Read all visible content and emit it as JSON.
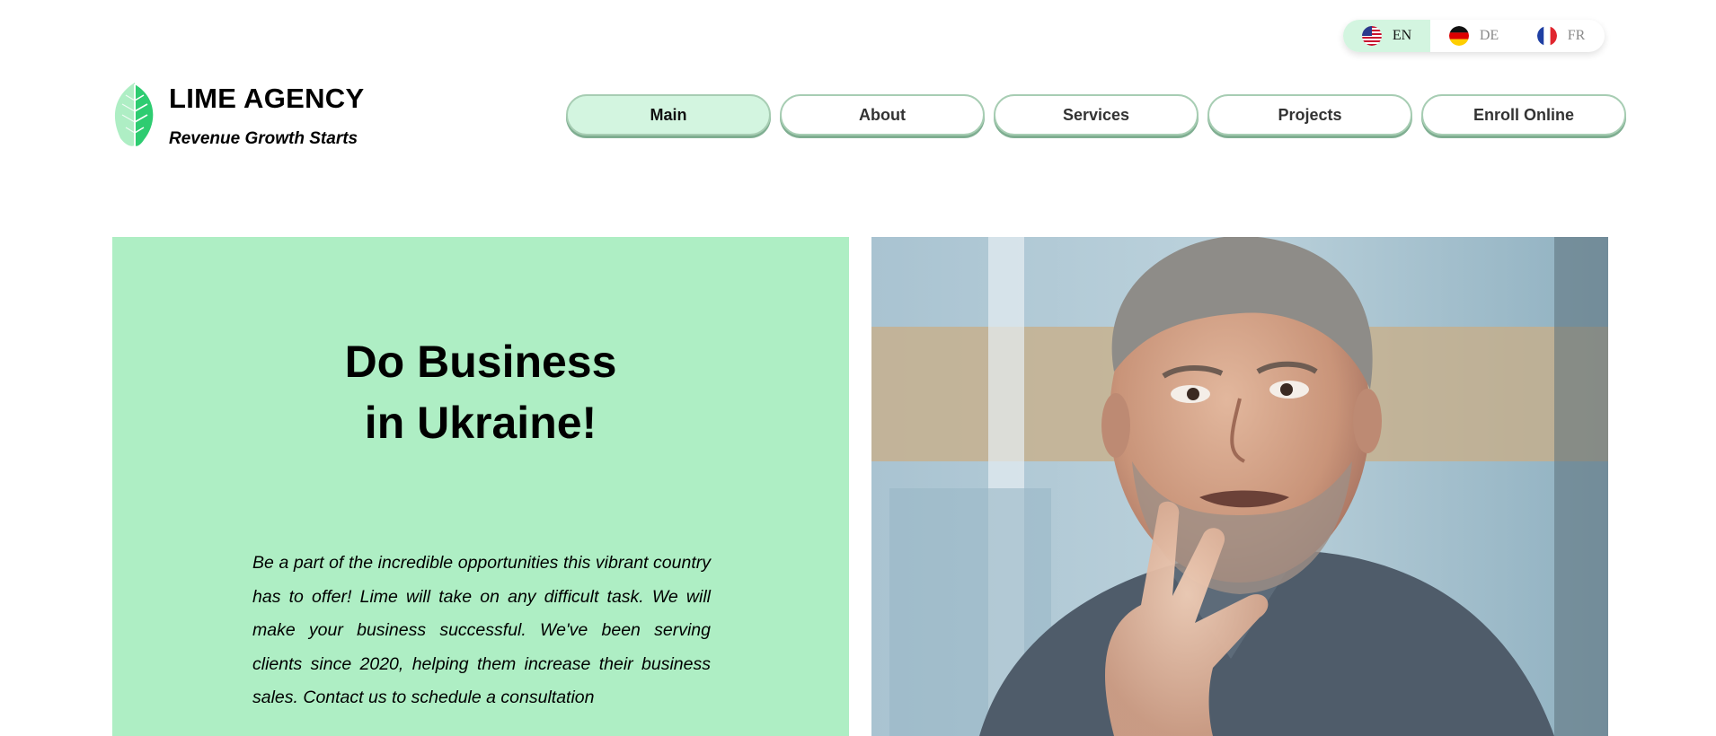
{
  "languages": [
    {
      "code": "EN",
      "flag": "us-flag-icon",
      "active": true
    },
    {
      "code": "DE",
      "flag": "germany-flag-icon",
      "active": false
    },
    {
      "code": "FR",
      "flag": "france-flag-icon",
      "active": false
    }
  ],
  "logo": {
    "title": "LIME AGENCY",
    "tagline": "Revenue Growth Starts",
    "icon": "leaf-icon"
  },
  "nav": {
    "items": [
      "Main",
      "About",
      "Services",
      "Projects",
      "Enroll Online"
    ],
    "active": "Main"
  },
  "hero": {
    "title_line1": "Do Business",
    "title_line2": "in Ukraine!",
    "text": "Be a part of the incredible opportunities this vibrant country has to offer! Lime will take on any difficult task. We will make your business successful. We've been serving clients since 2020, helping them increase their business sales. Contact us to schedule a consultation",
    "photo": "man-speaking-photo"
  },
  "colors": {
    "accent_mint": "#aeeec4",
    "active_button": "#d3f5e0",
    "button_border": "#a7cdb3",
    "leaf_green": "#2ecc71"
  }
}
